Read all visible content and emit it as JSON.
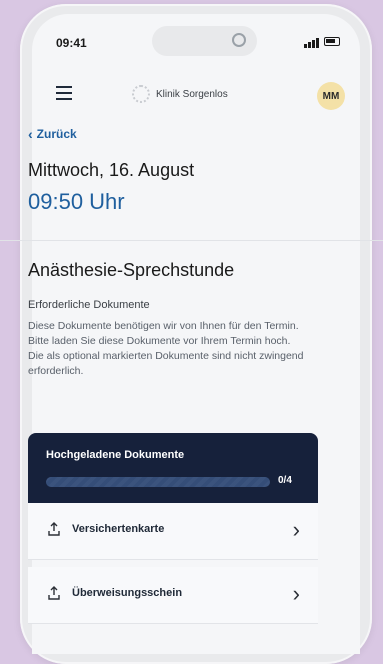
{
  "status_bar": {
    "time": "09:41"
  },
  "app_header": {
    "logo_text": "Klinik Sorgenlos",
    "avatar_initials": "MM"
  },
  "nav": {
    "back_label": "Zurück"
  },
  "appointment": {
    "date": "Mittwoch, 16. August",
    "time": "09:50 Uhr"
  },
  "section": {
    "title": "Anästhesie-Sprechstunde",
    "subtitle": "Erforderliche Dokumente",
    "description": "Diese Dokumente benötigen wir von Ihnen für den Termin. Bitte laden Sie diese Dokumente vor Ihrem Termin hoch. Die als optional markierten Dokumente sind nicht zwingend erforderlich."
  },
  "upload_panel": {
    "title": "Hochgeladene Dokumente",
    "count_label": "0/4",
    "progress_fraction": 0.0
  },
  "documents": [
    {
      "label": "Versichertenkarte",
      "icon": "upload-icon",
      "chevron": "chevron-right-icon"
    },
    {
      "label": "Überweisungsschein",
      "icon": "upload-icon",
      "chevron": "chevron-right-icon"
    }
  ],
  "colors": {
    "accent_blue": "#1f5f9e",
    "card_dark": "#16213b",
    "avatar": "#f4e1a7"
  }
}
